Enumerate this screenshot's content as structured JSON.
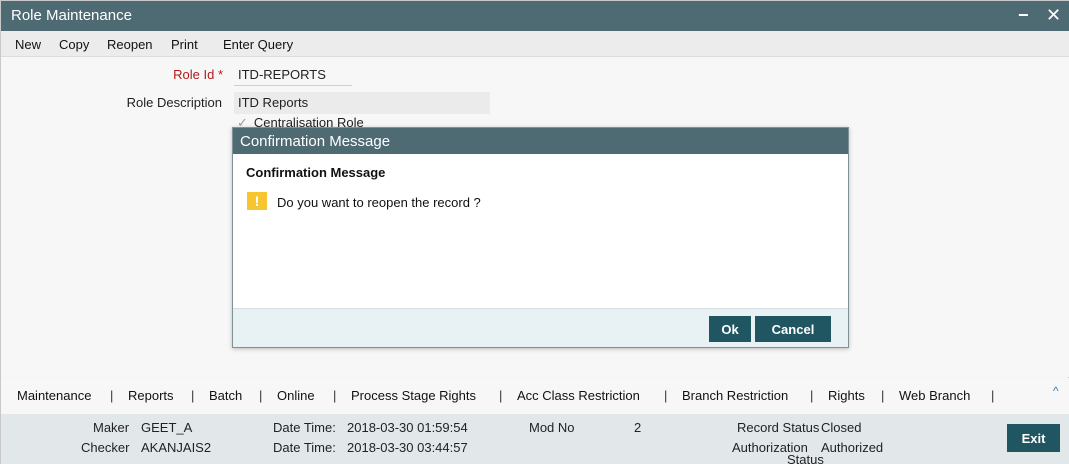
{
  "window": {
    "title": "Role Maintenance",
    "minimize": "−",
    "close": "✕"
  },
  "menu": [
    "New",
    "Copy",
    "Reopen",
    "Print",
    "Enter Query"
  ],
  "form": {
    "role_id_label": "Role Id",
    "required_marker": "*",
    "role_id_value": "ITD-REPORTS",
    "role_desc_label": "Role Description",
    "role_desc_value": "ITD Reports",
    "centralisation_label": "Centralisation Role"
  },
  "modal": {
    "title": "Confirmation Message",
    "heading": "Confirmation Message",
    "icon": "warning-icon",
    "icon_glyph": "!",
    "message": "Do you want to reopen the record ?",
    "ok_label": "Ok",
    "cancel_label": "Cancel"
  },
  "tabs": [
    "Maintenance",
    "Reports",
    "Batch",
    "Online",
    "Process Stage Rights",
    "Acc Class Restriction",
    "Branch Restriction",
    "Rights",
    "Web Branch"
  ],
  "tab_separator": "|",
  "collapse_glyph": "^",
  "status": {
    "maker_label": "Maker",
    "maker_value": "GEET_A",
    "checker_label": "Checker",
    "checker_value": "AKANJAIS2",
    "maker_dt_label": "Date Time:",
    "maker_dt_value": "2018-03-30 01:59:54",
    "checker_dt_label": "Date Time:",
    "checker_dt_value": "2018-03-30 03:44:57",
    "mod_no_label": "Mod No",
    "mod_no_value": "2",
    "record_status_label": "Record Status",
    "record_status_value": "Closed",
    "auth_status_label_1": "Authorization",
    "auth_status_label_2": "Status",
    "auth_status_value": "Authorized",
    "exit_label": "Exit"
  },
  "colors": {
    "header": "#4e6a72",
    "button": "#1f5661",
    "required": "#c0161b",
    "warning": "#f7c62e"
  }
}
